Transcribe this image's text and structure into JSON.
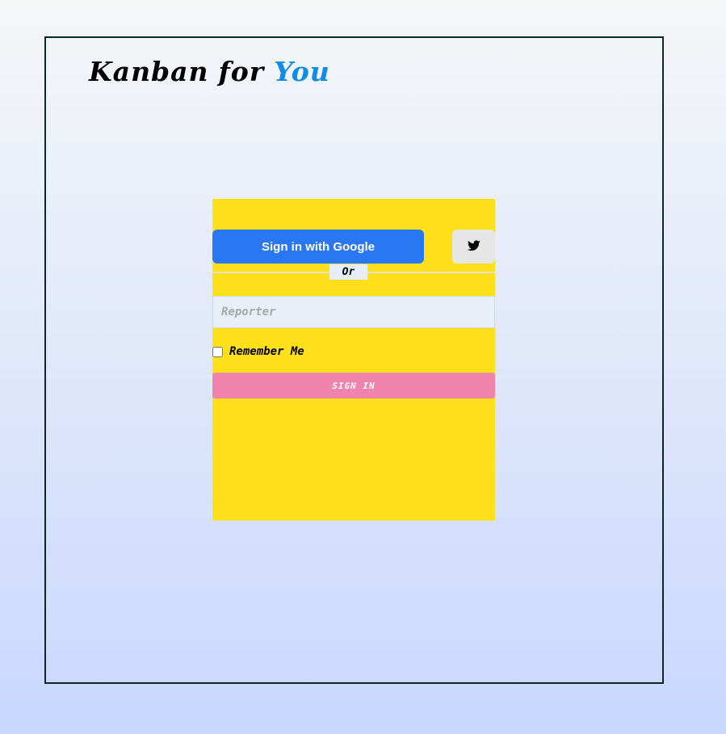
{
  "brand": {
    "part1": "Kanban",
    "part2": "for",
    "part3": "You",
    "accent_color": "#0f8de6"
  },
  "login": {
    "google_label": "Sign in with Google",
    "twitter_icon": "twitter-bird-icon",
    "or_label": "Or",
    "reporter_placeholder": "Reporter",
    "reporter_value": "",
    "remember_label": "Remember Me",
    "remember_checked": false,
    "signin_label": "SIGN IN"
  },
  "colors": {
    "card": "#ffe01b",
    "google": "#2a77f4",
    "signin": "#f084ac",
    "twitter_bg": "#e6e6e6"
  }
}
